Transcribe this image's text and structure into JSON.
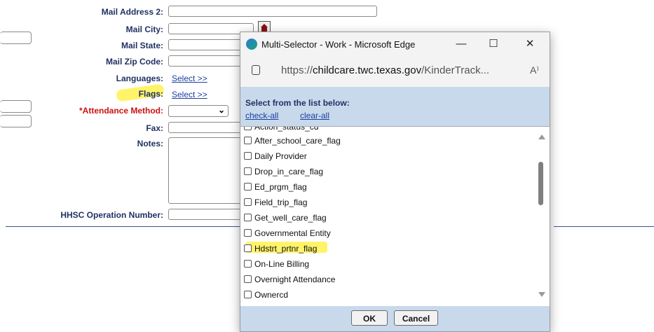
{
  "form": {
    "mail_address_2": "Mail Address 2:",
    "mail_city": "Mail City:",
    "mail_state": "Mail State:",
    "mail_zip": "Mail Zip Code:",
    "languages": "Languages:",
    "flags": "Flags:",
    "attendance_method": "*Attendance Method:",
    "fax": "Fax:",
    "notes": "Notes:",
    "hhsc": "HHSC Operation Number:",
    "select_link": "Select >>"
  },
  "popup": {
    "window_title": "Multi-Selector - Work - Microsoft Edge",
    "minimize": "—",
    "maximize": "☐",
    "close": "✕",
    "url_prefix": "https://",
    "url_host": "childcare.twc.texas.gov",
    "url_path": "/KinderTrack...",
    "read_aloud": "A⁾",
    "header_title": "Select from the list below:",
    "check_all": "check-all",
    "clear_all": "clear-all",
    "partial_item": "Action_status_cd",
    "items": [
      "After_school_care_flag",
      "Daily Provider",
      "Drop_in_care_flag",
      "Ed_prgm_flag",
      "Field_trip_flag",
      "Get_well_care_flag",
      "Governmental Entity",
      "Hdstrt_prtnr_flag",
      "On-Line Billing",
      "Overnight Attendance",
      "Ownercd"
    ],
    "ok": "OK",
    "cancel": "Cancel"
  },
  "colors": {
    "label": "#1f3264",
    "required": "#cc1111",
    "link": "#1a3fa0",
    "highlight": "#fff36a",
    "panel": "#c9d9ec"
  }
}
